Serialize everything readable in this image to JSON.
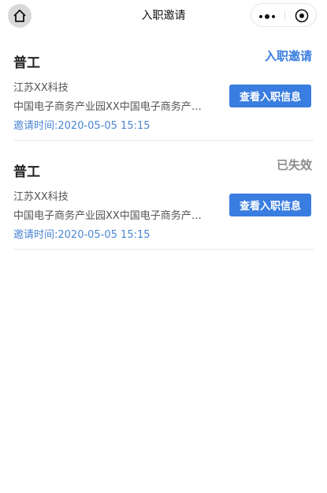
{
  "nav": {
    "title": "入职邀请",
    "home_icon": "home-icon",
    "more_icon": "more-dots-icon",
    "close_icon": "target-close-icon"
  },
  "colors": {
    "accent": "#3a7de0",
    "status_active": "#3a7de0",
    "status_expired": "#8c8c8c",
    "time_text": "#4a86d4"
  },
  "cards": [
    {
      "job": "普工",
      "status": "入职邀请",
      "company": "江苏XX科技",
      "address": "中国电子商务产业园XX中国电子商务产业园XX中国电子商务产业园",
      "time": "邀请时间:2020-05-05 15:15",
      "button": "查看入职信息"
    },
    {
      "job": "普工",
      "status": "已失效",
      "company": "江苏XX科技",
      "address": "中国电子商务产业园XX中国电子商务产业园XX中国电子商务产业园",
      "time": "邀请时间:2020-05-05 15:15",
      "button": "查看入职信息"
    }
  ]
}
